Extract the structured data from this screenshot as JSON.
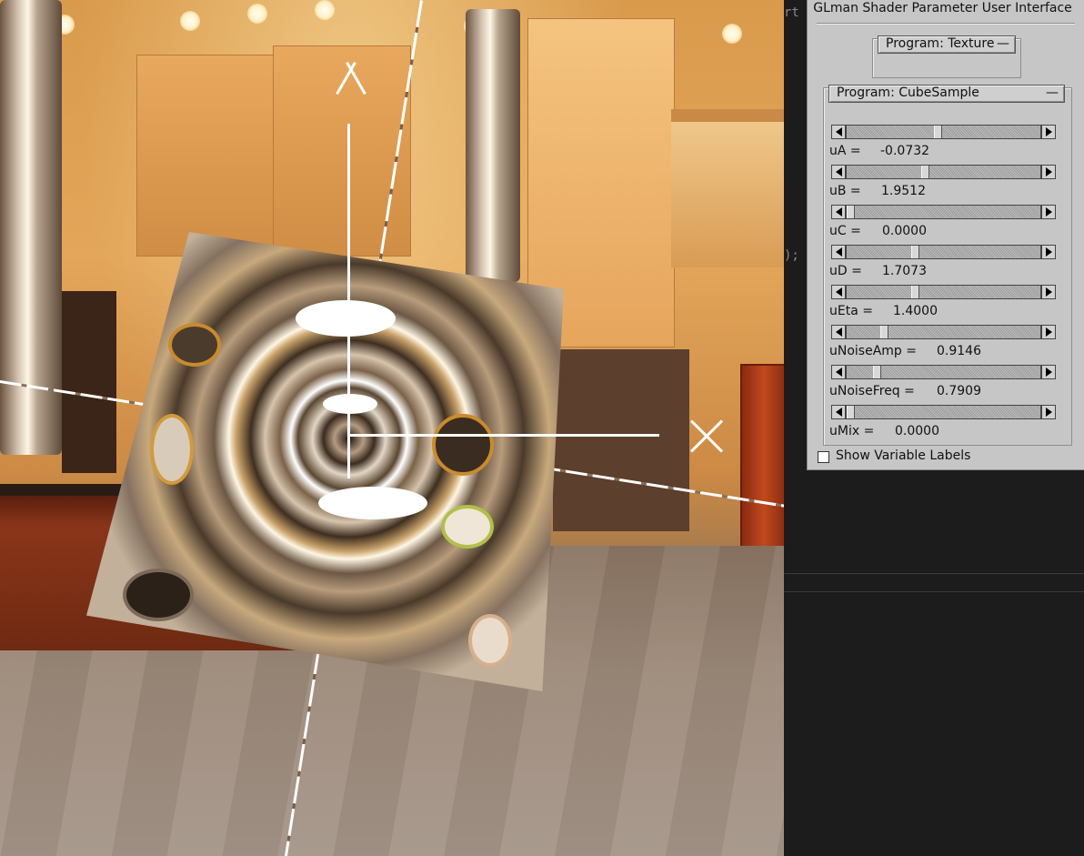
{
  "editor": {
    "frag_top": "rt t",
    "frag_mid": ");"
  },
  "panel": {
    "title": "GLman Shader Parameter User Interface",
    "programs": [
      {
        "label": "Program: Texture",
        "collapse_glyph": "—"
      },
      {
        "label": "Program: CubeSample",
        "collapse_glyph": "—"
      }
    ],
    "parameters": [
      {
        "name": "uA =",
        "value": "-0.0732",
        "slider_fraction": 0.47
      },
      {
        "name": "uB =",
        "value": "1.9512",
        "slider_fraction": 0.4
      },
      {
        "name": "uC =",
        "value": "0.0000",
        "slider_fraction": 0.0
      },
      {
        "name": "uD =",
        "value": "1.7073",
        "slider_fraction": 0.35
      },
      {
        "name": "uEta =",
        "value": "1.4000",
        "slider_fraction": 0.35
      },
      {
        "name": "uNoiseAmp =",
        "value": "0.9146",
        "slider_fraction": 0.18
      },
      {
        "name": "uNoiseFreq =",
        "value": "0.7909",
        "slider_fraction": 0.14
      },
      {
        "name": "uMix =",
        "value": "0.0000",
        "slider_fraction": 0.0
      }
    ],
    "show_labels": {
      "label": "Show Variable Labels",
      "checked": false
    }
  }
}
